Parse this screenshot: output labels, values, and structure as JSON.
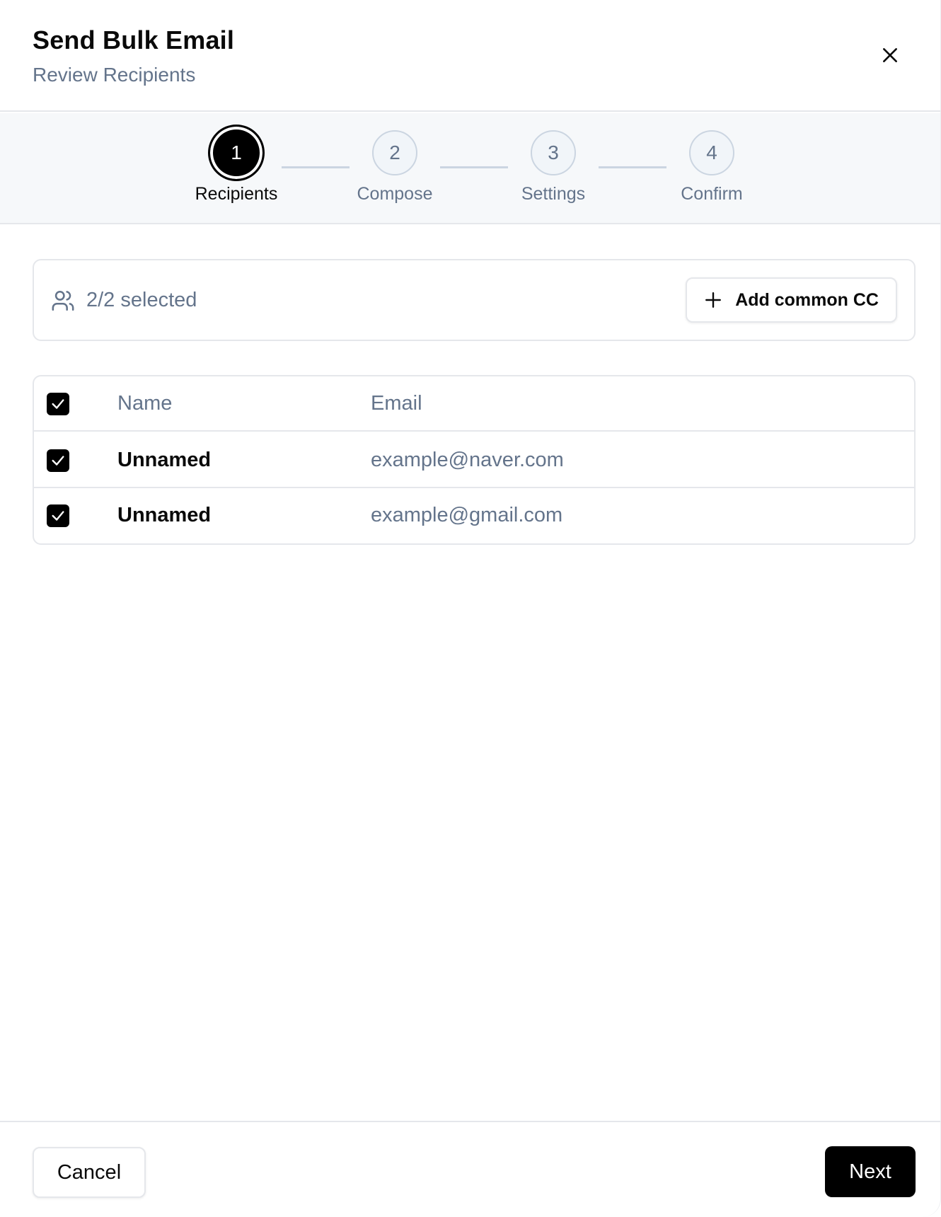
{
  "dialog": {
    "title": "Send Bulk Email",
    "subtitle": "Review Recipients"
  },
  "stepper": {
    "steps": [
      {
        "number": "1",
        "label": "Recipients",
        "active": true
      },
      {
        "number": "2",
        "label": "Compose",
        "active": false
      },
      {
        "number": "3",
        "label": "Settings",
        "active": false
      },
      {
        "number": "4",
        "label": "Confirm",
        "active": false
      }
    ]
  },
  "summary": {
    "icon": "users-icon",
    "selected_text": "2/2 selected",
    "cc_button_label": "Add common CC"
  },
  "table": {
    "columns": [
      "Name",
      "Email"
    ],
    "header_checked": true,
    "rows": [
      {
        "name": "Unnamed",
        "email": "example@naver.com",
        "checked": true
      },
      {
        "name": "Unnamed",
        "email": "example@gmail.com",
        "checked": true
      }
    ]
  },
  "footer": {
    "cancel_label": "Cancel",
    "next_label": "Next"
  },
  "colors": {
    "primary": "#000000",
    "muted_text": "#64748b",
    "border": "#e5e7eb",
    "stepper_bg": "#f6f8fa"
  }
}
